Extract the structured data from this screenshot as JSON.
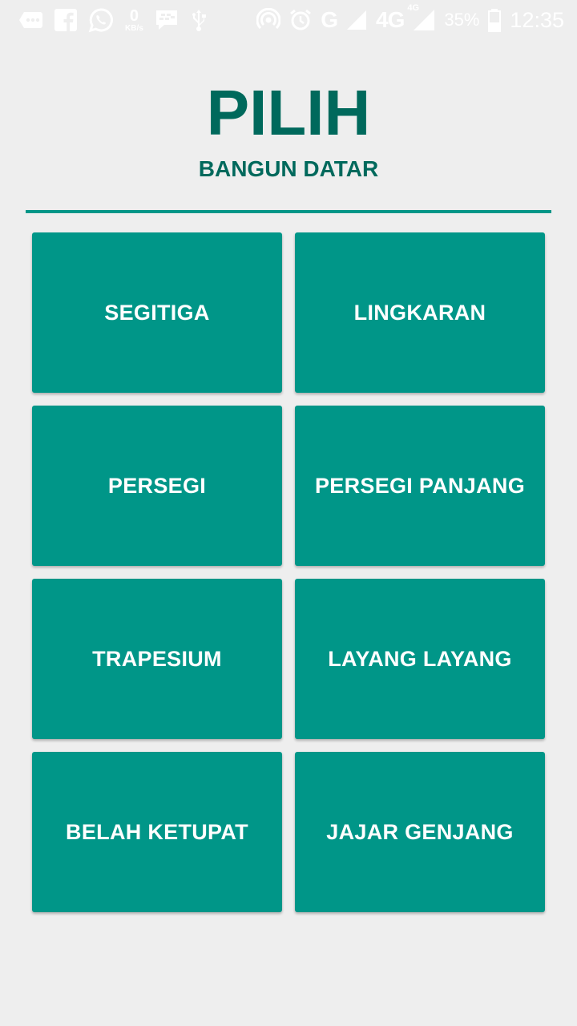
{
  "status_bar": {
    "speed_value": "0",
    "speed_unit": "KB/s",
    "network_g": "G",
    "network_4g": "4G",
    "network_4g_small": "4G",
    "battery": "35%",
    "time": "12:35",
    "icons": [
      "chat-icon",
      "facebook-icon",
      "whatsapp-icon",
      "bbm-icon",
      "usb-icon",
      "hotspot-icon",
      "alarm-icon",
      "signal-icon",
      "signal-icon",
      "battery-icon"
    ]
  },
  "header": {
    "title": "PILIH",
    "subtitle": "BANGUN DATAR"
  },
  "shapes": [
    {
      "label": "SEGITIGA"
    },
    {
      "label": "LINGKARAN"
    },
    {
      "label": "PERSEGI"
    },
    {
      "label": "PERSEGI PANJANG"
    },
    {
      "label": "TRAPESIUM"
    },
    {
      "label": "LAYANG LAYANG"
    },
    {
      "label": "BELAH KETUPAT"
    },
    {
      "label": "JAJAR GENJANG"
    }
  ],
  "colors": {
    "background": "#eeeeee",
    "accent": "#009688",
    "title": "#00695c",
    "button_text": "#ffffff"
  }
}
